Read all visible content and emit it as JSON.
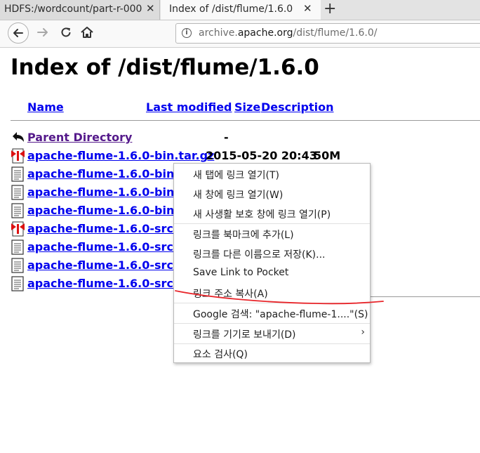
{
  "tabs": [
    {
      "title": "HDFS:/wordcount/part-r-000",
      "close": "✕",
      "active": false
    },
    {
      "title": "Index of /dist/flume/1.6.0",
      "close": "✕",
      "active": true
    }
  ],
  "new_tab": "+",
  "nav": {
    "back_icon": "back-arrow-icon",
    "forward_icon": "forward-arrow-icon",
    "reload_icon": "reload-icon",
    "home_icon": "home-icon",
    "url_prefix": "archive.",
    "url_domain": "apache.org",
    "url_path": "/dist/flume/1.6.0/",
    "info_icon": "i"
  },
  "page": {
    "title": "Index of /dist/flume/1.6.0",
    "columns": [
      "Name",
      "Last modified",
      "Size",
      "Description"
    ],
    "rows": [
      {
        "name": "Parent Directory",
        "modified": "",
        "size": "-",
        "icon": "back-folder-icon"
      },
      {
        "name": "apache-flume-1.6.0-bin.tar.gz",
        "modified": "2015-05-20 20:43",
        "size": "50M",
        "icon": "archive-icon"
      },
      {
        "name": "apache-flume-1.6.0-bin.tar",
        "modified": "",
        "size": "",
        "icon": "text-file-icon"
      },
      {
        "name": "apache-flume-1.6.0-bin.tar",
        "modified": "",
        "size": "",
        "icon": "text-file-icon"
      },
      {
        "name": "apache-flume-1.6.0-bin.tar",
        "modified": "",
        "size": "",
        "icon": "text-file-icon"
      },
      {
        "name": "apache-flume-1.6.0-src.tar.",
        "modified": "",
        "size": "",
        "icon": "archive-icon"
      },
      {
        "name": "apache-flume-1.6.0-src.tar.",
        "modified": "",
        "size": "",
        "icon": "text-file-icon"
      },
      {
        "name": "apache-flume-1.6.0-src.tar.",
        "modified": "",
        "size": "",
        "icon": "text-file-icon"
      },
      {
        "name": "apache-flume-1.6.0-src.tar.",
        "modified": "",
        "size": "",
        "icon": "text-file-icon"
      }
    ]
  },
  "context_menu": {
    "items": [
      "새 탭에 링크 열기(T)",
      "새 창에 링크 열기(W)",
      "새 사생활 보호 창에 링크 열기(P)",
      "링크를 북마크에 추가(L)",
      "링크를 다른 이름으로 저장(K)...",
      "Save Link to Pocket",
      "링크 주소 복사(A)",
      "Google 검색: \"apache-flume-1....\"(S)",
      "링크를 기기로 보내기(D)",
      "요소 검사(Q)"
    ],
    "submenu_arrow": "›",
    "annotation_color": "#e8262b"
  }
}
